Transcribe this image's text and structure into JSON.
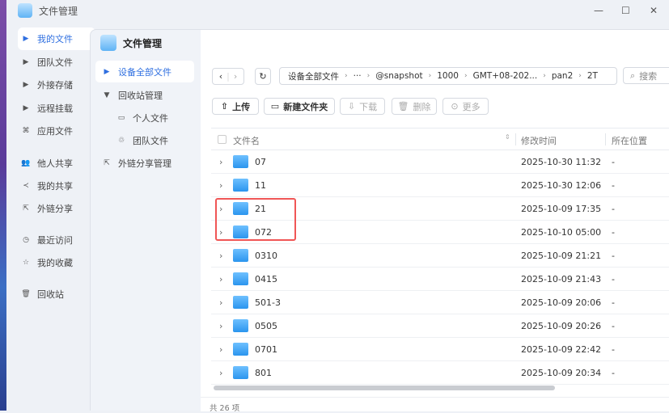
{
  "window": {
    "title": "文件管理",
    "controls": [
      "—",
      "☐",
      "✕"
    ]
  },
  "left_nav": [
    {
      "label": "我的文件",
      "icon": "caret-right-icon",
      "active": true
    },
    {
      "label": "团队文件",
      "icon": "caret-right-icon"
    },
    {
      "label": "外接存储",
      "icon": "caret-right-icon"
    },
    {
      "label": "远程挂载",
      "icon": "caret-right-icon"
    },
    {
      "label": "应用文件",
      "icon": "apps-icon"
    },
    {
      "label": "他人共享",
      "icon": "users-icon"
    },
    {
      "label": "我的共享",
      "icon": "share-icon"
    },
    {
      "label": "外链分享",
      "icon": "external-link-icon"
    },
    {
      "label": "最近访问",
      "icon": "clock-icon"
    },
    {
      "label": "我的收藏",
      "icon": "star-icon"
    },
    {
      "label": "回收站",
      "icon": "trash-icon"
    }
  ],
  "inner": {
    "title": "文件管理",
    "sidebar": [
      {
        "label": "设备全部文件",
        "icon": "caret-right-icon",
        "active": true
      },
      {
        "label": "回收站管理",
        "icon": "caret-down-icon"
      },
      {
        "label": "个人文件",
        "icon": "folder-outline-icon"
      },
      {
        "label": "团队文件",
        "icon": "team-icon"
      },
      {
        "label": "外链分享管理",
        "icon": "external-link-icon"
      }
    ],
    "breadcrumb": [
      "设备全部文件",
      "···",
      "@snapshot",
      "1000",
      "GMT+08-202...",
      "pan2",
      "2T"
    ],
    "search_placeholder": "搜索",
    "toolbar": {
      "upload": "上传",
      "new_folder": "新建文件夹",
      "download": "下载",
      "delete": "删除",
      "more": "更多"
    },
    "columns": {
      "name": "文件名",
      "modified": "修改时间",
      "location": "所在位置"
    },
    "rows": [
      {
        "name": "07",
        "modified": "2025-10-30 11:32",
        "location": "-"
      },
      {
        "name": "11",
        "modified": "2025-10-30 12:06",
        "location": "-"
      },
      {
        "name": "21",
        "modified": "2025-10-09 17:35",
        "location": "-",
        "highlighted": true
      },
      {
        "name": "072",
        "modified": "2025-10-10 05:00",
        "location": "-",
        "highlighted": true
      },
      {
        "name": "0310",
        "modified": "2025-10-09 21:21",
        "location": "-"
      },
      {
        "name": "0415",
        "modified": "2025-10-09 21:43",
        "location": "-"
      },
      {
        "name": "501-3",
        "modified": "2025-10-09 20:06",
        "location": "-"
      },
      {
        "name": "0505",
        "modified": "2025-10-09 20:26",
        "location": "-"
      },
      {
        "name": "0701",
        "modified": "2025-10-09 22:42",
        "location": "-"
      },
      {
        "name": "801",
        "modified": "2025-10-09 20:34",
        "location": "-"
      }
    ],
    "footer": "共 26 项"
  },
  "colors": {
    "accent": "#2f6fe0",
    "highlight": "#f05656",
    "folder": "#2b95ee"
  }
}
